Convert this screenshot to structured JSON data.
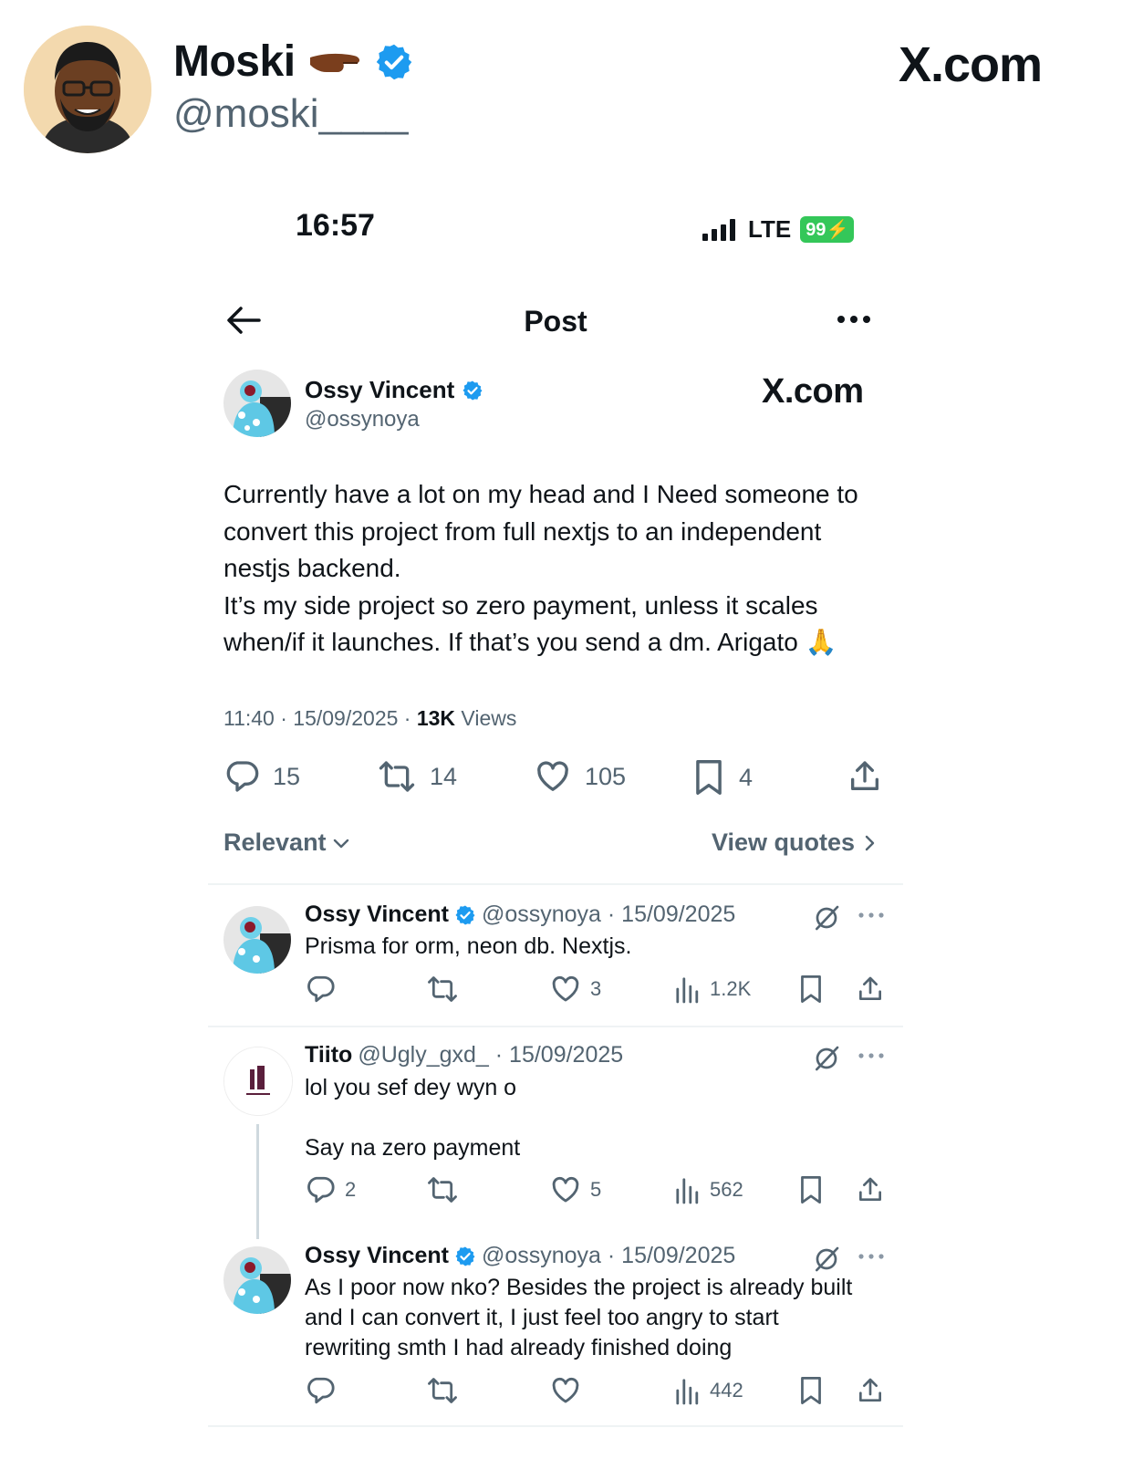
{
  "quote_card": {
    "author_name": "Moski",
    "author_handle": "@moski____",
    "brand": "X.com"
  },
  "status_bar": {
    "time": "16:57",
    "network": "LTE",
    "battery": "99"
  },
  "nav": {
    "title": "Post"
  },
  "post": {
    "author_name": "Ossy Vincent",
    "author_handle": "@ossynoya",
    "brand": "X.com",
    "text": "Currently have a lot on my head and I Need someone to\nconvert this project from full nextjs to an independent\nnestjs backend.\nIt’s my side project so zero payment, unless it scales\nwhen/if it launches. If that’s you send a dm. Arigato 🙏",
    "time": "11:40 · 15/09/2025 · ",
    "views_count": "13K",
    "views_label": " Views",
    "stats": {
      "replies": "15",
      "reposts": "14",
      "likes": "105",
      "bookmarks": "4"
    }
  },
  "filters": {
    "sort_label": "Relevant",
    "view_quotes_label": "View quotes"
  },
  "replies": [
    {
      "name": "Ossy Vincent",
      "handle": "@ossynoya · 15/09/2025",
      "text": "Prisma for orm, neon db. Nextjs.",
      "replies": "",
      "likes": "3",
      "views": "1.2K"
    },
    {
      "name": "Tiito",
      "handle": "@Ugly_gxd_ · 15/09/2025",
      "text": "lol you sef dey wyn o\n\nSay na zero payment",
      "replies": "2",
      "likes": "5",
      "views": "562"
    },
    {
      "name": "Ossy Vincent",
      "handle": "@ossynoya · 15/09/2025",
      "text": "As I poor now nko? Besides the project is already built\nand I can convert it, I just feel too angry to start\nrewriting smth I had already finished doing",
      "replies": "",
      "likes": "",
      "views": "442"
    }
  ],
  "colors": {
    "verified": "#1d9bf0",
    "muted": "#536471",
    "battery": "#34c759"
  }
}
